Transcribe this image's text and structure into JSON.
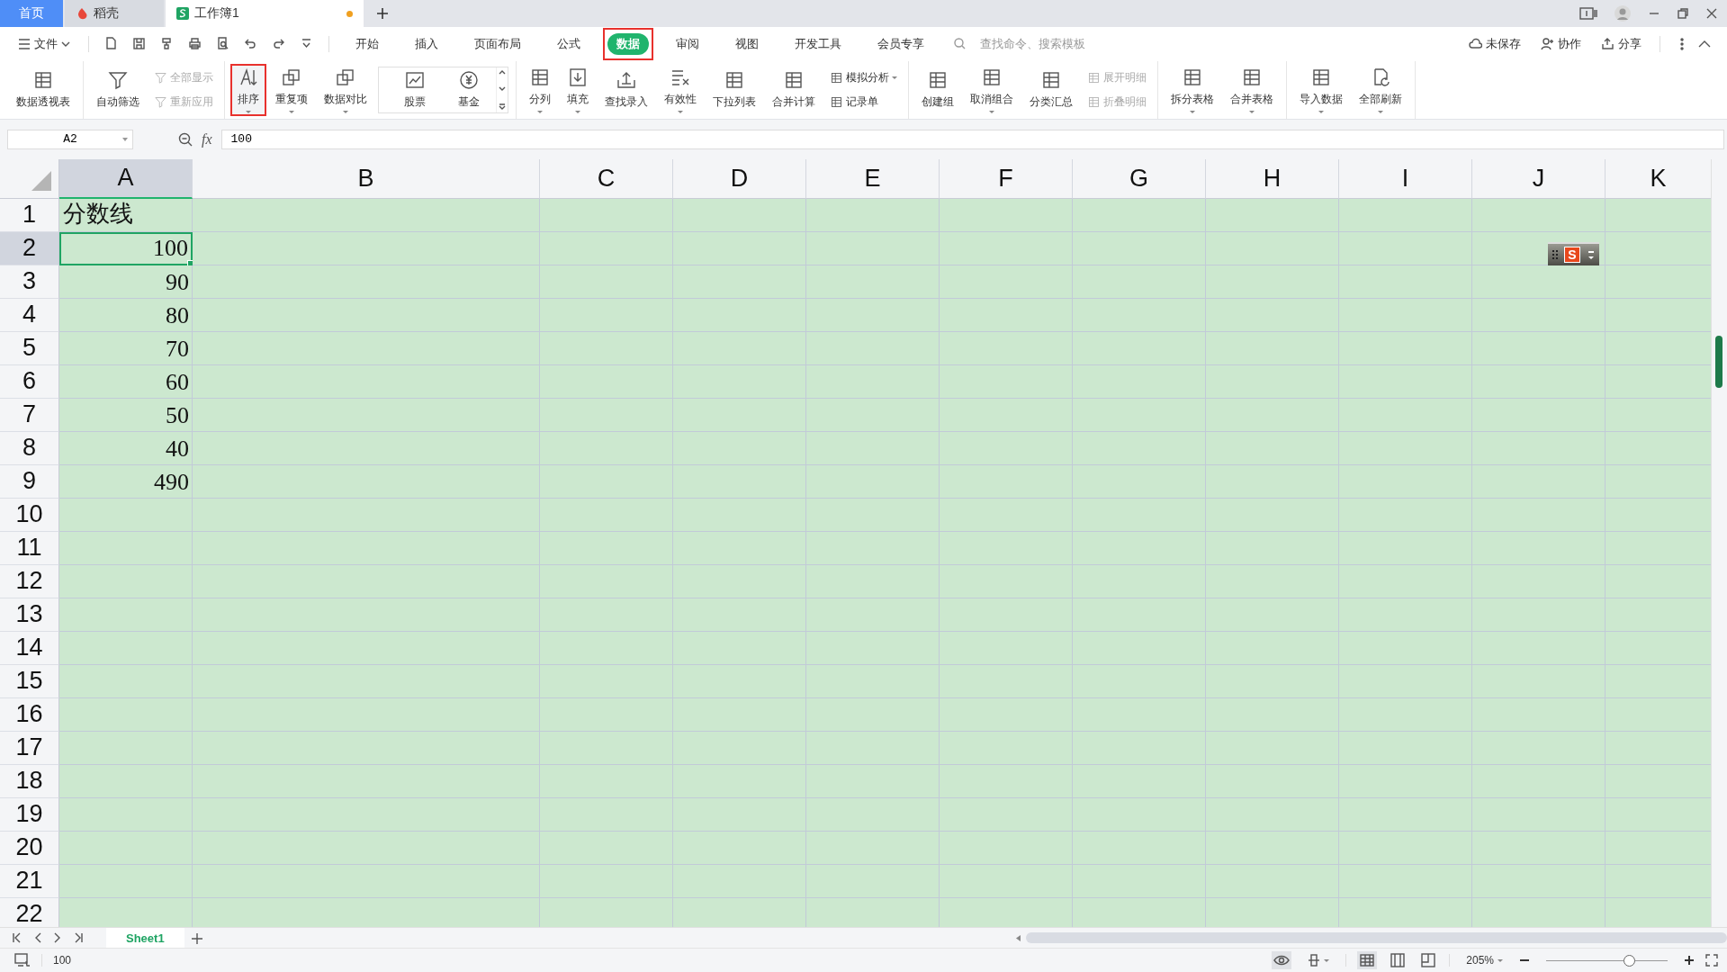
{
  "title_tabs": [
    {
      "kind": "home",
      "label": "首页",
      "selected": false,
      "modified": false
    },
    {
      "kind": "docer",
      "label": "稻壳",
      "selected": false,
      "modified": false
    },
    {
      "kind": "workbook",
      "label": "工作簿1",
      "selected": true,
      "modified": true
    }
  ],
  "menu": {
    "file": "文件",
    "tabs": [
      {
        "label": "开始",
        "selected": false,
        "highlighted": false
      },
      {
        "label": "插入",
        "selected": false,
        "highlighted": false
      },
      {
        "label": "页面布局",
        "selected": false,
        "highlighted": false
      },
      {
        "label": "公式",
        "selected": false,
        "highlighted": false
      },
      {
        "label": "数据",
        "selected": true,
        "highlighted": true
      },
      {
        "label": "审阅",
        "selected": false,
        "highlighted": false
      },
      {
        "label": "视图",
        "selected": false,
        "highlighted": false
      },
      {
        "label": "开发工具",
        "selected": false,
        "highlighted": false
      },
      {
        "label": "会员专享",
        "selected": false,
        "highlighted": false
      }
    ],
    "search": {
      "placeholder": "查找命令、搜索模板"
    },
    "actions": [
      {
        "kind": "cloud",
        "label": "未保存"
      },
      {
        "kind": "collab",
        "label": "协作"
      },
      {
        "kind": "share",
        "label": "分享"
      }
    ]
  },
  "ribbon": {
    "groups": [
      {
        "items": [
          {
            "label": "数据透视表",
            "kind": "large",
            "dropdown": false,
            "disabled": false,
            "highlighted": false
          }
        ]
      },
      {
        "items": [
          {
            "label": "自动筛选",
            "kind": "large",
            "dropdown": false,
            "disabled": false,
            "highlighted": false
          },
          {
            "label": "全部显示",
            "kind": "small",
            "dropdown": false,
            "disabled": true,
            "highlighted": false
          },
          {
            "label": "重新应用",
            "kind": "small",
            "dropdown": false,
            "disabled": true,
            "highlighted": false
          }
        ]
      },
      {
        "items": [
          {
            "label": "排序",
            "kind": "large",
            "dropdown": true,
            "disabled": false,
            "highlighted": true
          },
          {
            "label": "重复项",
            "kind": "large",
            "dropdown": true,
            "disabled": false,
            "highlighted": false
          },
          {
            "label": "数据对比",
            "kind": "large",
            "dropdown": true,
            "disabled": false,
            "highlighted": false
          },
          {
            "label": "股票",
            "kind": "gallery",
            "dropdown": false,
            "disabled": false,
            "highlighted": false
          },
          {
            "label": "基金",
            "kind": "gallery",
            "dropdown": false,
            "disabled": false,
            "highlighted": false
          }
        ]
      },
      {
        "items": [
          {
            "label": "分列",
            "kind": "large",
            "dropdown": true,
            "disabled": false,
            "highlighted": false
          },
          {
            "label": "填充",
            "kind": "large",
            "dropdown": true,
            "disabled": false,
            "highlighted": false
          },
          {
            "label": "查找录入",
            "kind": "large",
            "dropdown": false,
            "disabled": false,
            "highlighted": false
          },
          {
            "label": "有效性",
            "kind": "large",
            "dropdown": true,
            "disabled": false,
            "highlighted": false
          },
          {
            "label": "下拉列表",
            "kind": "large",
            "dropdown": false,
            "disabled": false,
            "highlighted": false
          },
          {
            "label": "合并计算",
            "kind": "large",
            "dropdown": false,
            "disabled": false,
            "highlighted": false
          },
          {
            "label": "模拟分析",
            "kind": "small",
            "dropdown": true,
            "disabled": false,
            "highlighted": false
          },
          {
            "label": "记录单",
            "kind": "small",
            "dropdown": false,
            "disabled": false,
            "highlighted": false
          }
        ]
      },
      {
        "items": [
          {
            "label": "创建组",
            "kind": "large",
            "dropdown": false,
            "disabled": false,
            "highlighted": false
          },
          {
            "label": "取消组合",
            "kind": "large",
            "dropdown": true,
            "disabled": false,
            "highlighted": false
          },
          {
            "label": "分类汇总",
            "kind": "large",
            "dropdown": false,
            "disabled": false,
            "highlighted": false
          },
          {
            "label": "展开明细",
            "kind": "small",
            "dropdown": false,
            "disabled": true,
            "highlighted": false
          },
          {
            "label": "折叠明细",
            "kind": "small",
            "dropdown": false,
            "disabled": true,
            "highlighted": false
          }
        ]
      },
      {
        "items": [
          {
            "label": "拆分表格",
            "kind": "large",
            "dropdown": true,
            "disabled": false,
            "highlighted": false
          },
          {
            "label": "合并表格",
            "kind": "large",
            "dropdown": true,
            "disabled": false,
            "highlighted": false
          }
        ]
      },
      {
        "items": [
          {
            "label": "导入数据",
            "kind": "large",
            "dropdown": true,
            "disabled": false,
            "highlighted": false
          },
          {
            "label": "全部刷新",
            "kind": "large",
            "dropdown": true,
            "disabled": false,
            "highlighted": false
          }
        ]
      }
    ]
  },
  "formula_bar": {
    "name_box": "A2",
    "fx_label": "fx",
    "formula": "100"
  },
  "sheet": {
    "columns": [
      {
        "label": "A",
        "selected": true
      },
      {
        "label": "B",
        "selected": false
      },
      {
        "label": "C",
        "selected": false
      },
      {
        "label": "D",
        "selected": false
      },
      {
        "label": "E",
        "selected": false
      },
      {
        "label": "F",
        "selected": false
      },
      {
        "label": "G",
        "selected": false
      },
      {
        "label": "H",
        "selected": false
      },
      {
        "label": "I",
        "selected": false
      },
      {
        "label": "J",
        "selected": false
      },
      {
        "label": "K",
        "selected": false
      }
    ],
    "rows": [
      {
        "number": "1",
        "selected": false,
        "cells": [
          {
            "text": "分数线",
            "kind": "text"
          }
        ]
      },
      {
        "number": "2",
        "selected": true,
        "cells": [
          {
            "text": "100",
            "kind": "number"
          }
        ]
      },
      {
        "number": "3",
        "selected": false,
        "cells": [
          {
            "text": "90",
            "kind": "number"
          }
        ]
      },
      {
        "number": "4",
        "selected": false,
        "cells": [
          {
            "text": "80",
            "kind": "number"
          }
        ]
      },
      {
        "number": "5",
        "selected": false,
        "cells": [
          {
            "text": "70",
            "kind": "number"
          }
        ]
      },
      {
        "number": "6",
        "selected": false,
        "cells": [
          {
            "text": "60",
            "kind": "number"
          }
        ]
      },
      {
        "number": "7",
        "selected": false,
        "cells": [
          {
            "text": "50",
            "kind": "number"
          }
        ]
      },
      {
        "number": "8",
        "selected": false,
        "cells": [
          {
            "text": "40",
            "kind": "number"
          }
        ]
      },
      {
        "number": "9",
        "selected": false,
        "cells": [
          {
            "text": "490",
            "kind": "number"
          }
        ]
      },
      {
        "number": "10",
        "selected": false,
        "cells": []
      },
      {
        "number": "11",
        "selected": false,
        "cells": []
      },
      {
        "number": "12",
        "selected": false,
        "cells": []
      },
      {
        "number": "13",
        "selected": false,
        "cells": []
      },
      {
        "number": "14",
        "selected": false,
        "cells": []
      },
      {
        "number": "15",
        "selected": false,
        "cells": []
      },
      {
        "number": "16",
        "selected": false,
        "cells": []
      },
      {
        "number": "17",
        "selected": false,
        "cells": []
      },
      {
        "number": "18",
        "selected": false,
        "cells": []
      },
      {
        "number": "19",
        "selected": false,
        "cells": []
      },
      {
        "number": "20",
        "selected": false,
        "cells": []
      },
      {
        "number": "21",
        "selected": false,
        "cells": []
      },
      {
        "number": "22",
        "selected": false,
        "cells": []
      }
    ]
  },
  "ime_toolbar": {
    "logo": "S"
  },
  "sheet_tabs": [
    {
      "label": "Sheet1",
      "selected": true
    }
  ],
  "status_bar": {
    "text": "100",
    "views": [
      {
        "selected": true
      },
      {
        "selected": false
      },
      {
        "selected": false
      }
    ],
    "zoom": "205%",
    "zoom_slider": {
      "level": 0.68
    }
  }
}
